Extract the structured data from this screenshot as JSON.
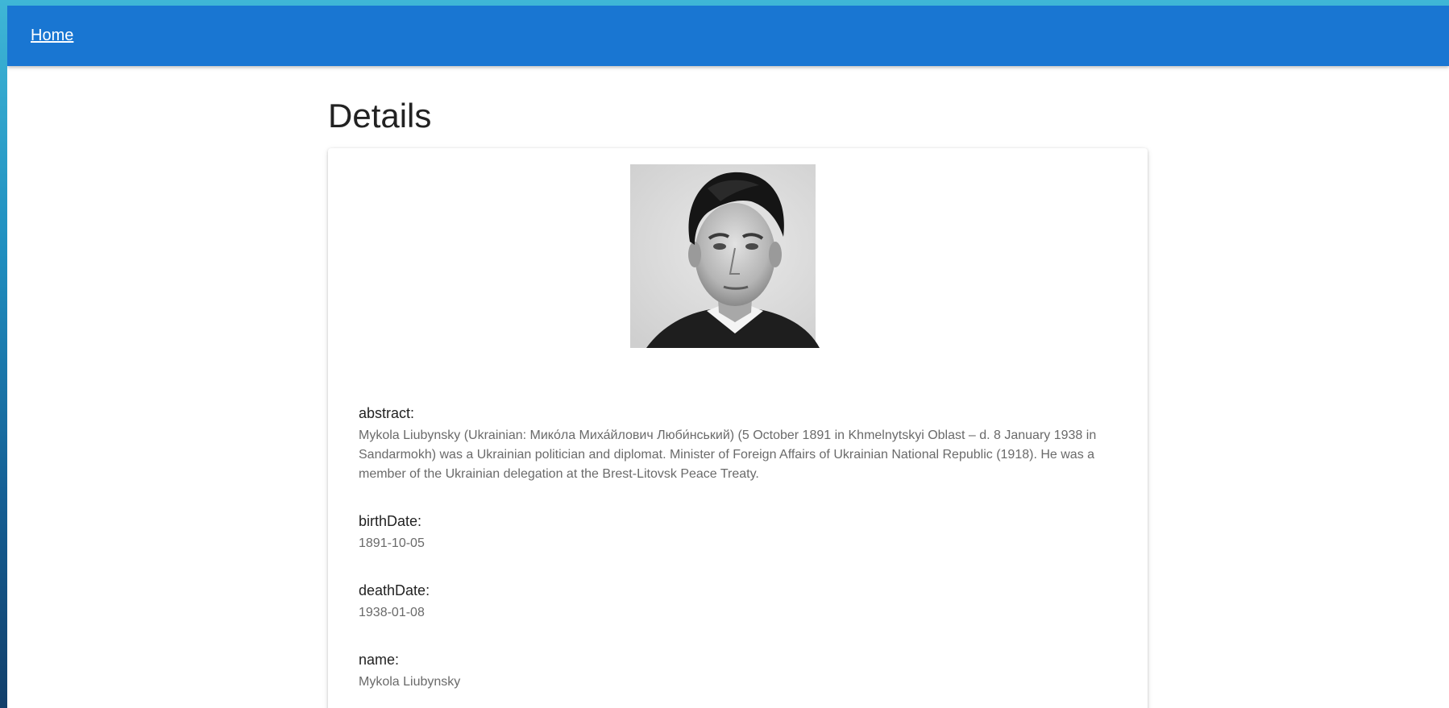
{
  "nav": {
    "home_label": "Home"
  },
  "page": {
    "title": "Details"
  },
  "photo": {
    "icon": "portrait-photo"
  },
  "fields": [
    {
      "label": "abstract:",
      "value": "Mykola Liubynsky (Ukrainian: Мико́ла Миха́йлович Люби́нський) (5 October 1891 in Khmelnytskyi Oblast – d. 8 January 1938 in Sandarmokh) was a Ukrainian politician and diplomat. Minister of Foreign Affairs of Ukrainian National Republic (1918). He was a member of the Ukrainian delegation at the Brest-Litovsk Peace Treaty."
    },
    {
      "label": "birthDate:",
      "value": "1891-10-05"
    },
    {
      "label": "deathDate:",
      "value": "1938-01-08"
    },
    {
      "label": "name:",
      "value": "Mykola Liubynsky"
    }
  ],
  "colors": {
    "appbar": "#1976d2",
    "background_gradient_top": "#3fb6d6",
    "background_gradient_bottom": "#123f6a"
  }
}
